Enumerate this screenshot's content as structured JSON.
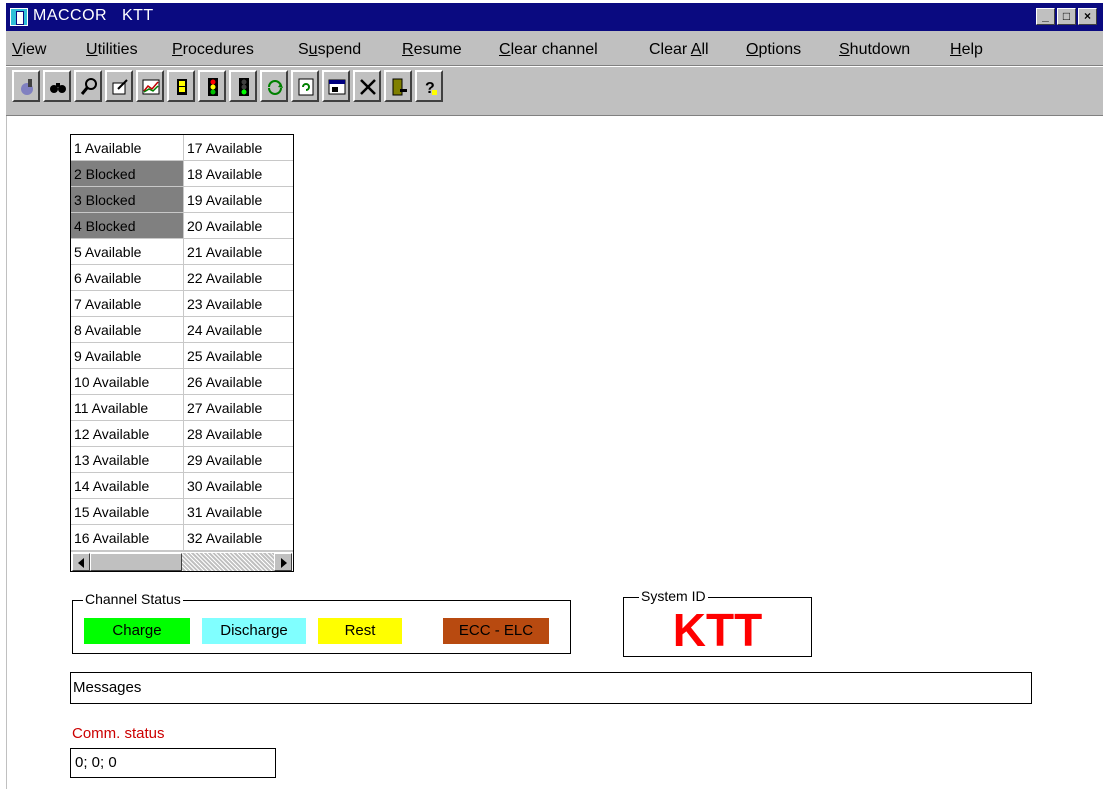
{
  "window": {
    "app_name": "MACCOR",
    "system": "KTT",
    "min_glyph": "_",
    "max_glyph": "□",
    "close_glyph": "×"
  },
  "menu": {
    "items": [
      {
        "label": "View",
        "underline": "V",
        "rest": "iew"
      },
      {
        "label": "Utilities",
        "underline": "U",
        "rest": "tilities"
      },
      {
        "label": "Procedures",
        "underline": "P",
        "rest": "rocedures"
      },
      {
        "label": "Suspend",
        "pre": "S",
        "underline": "u",
        "rest": "spend"
      },
      {
        "label": "Resume",
        "underline": "R",
        "rest": "esume"
      },
      {
        "label": "Clear channel",
        "underline": "C",
        "rest": "lear channel"
      },
      {
        "label": "Clear All",
        "pre": "Clear ",
        "underline": "A",
        "rest": "ll"
      },
      {
        "label": "Options",
        "underline": "O",
        "rest": "ptions"
      },
      {
        "label": "Shutdown",
        "underline": "S",
        "rest": "hutdown"
      },
      {
        "label": "Help",
        "underline": "H",
        "rest": "elp"
      }
    ]
  },
  "toolbar": {
    "icons": [
      "run-test-icon",
      "binoculars-icon",
      "magnifier-icon",
      "edit-icon",
      "graph-icon",
      "battery-icon",
      "traffic-light-icon",
      "traffic-light-green-icon",
      "cycle-icon",
      "refresh-page-icon",
      "window-icon",
      "delete-icon",
      "door-exit-icon",
      "help-icon"
    ]
  },
  "channels": {
    "column1": [
      {
        "text": "1 Available",
        "state": "available"
      },
      {
        "text": "2 Blocked",
        "state": "blocked"
      },
      {
        "text": "3 Blocked",
        "state": "blocked"
      },
      {
        "text": "4 Blocked",
        "state": "blocked"
      },
      {
        "text": "5 Available",
        "state": "available"
      },
      {
        "text": "6 Available",
        "state": "available"
      },
      {
        "text": "7 Available",
        "state": "available"
      },
      {
        "text": "8 Available",
        "state": "available"
      },
      {
        "text": "9 Available",
        "state": "available"
      },
      {
        "text": "10 Available",
        "state": "available"
      },
      {
        "text": "11 Available",
        "state": "available"
      },
      {
        "text": "12 Available",
        "state": "available"
      },
      {
        "text": "13 Available",
        "state": "available"
      },
      {
        "text": "14 Available",
        "state": "available"
      },
      {
        "text": "15 Available",
        "state": "available"
      },
      {
        "text": "16 Available",
        "state": "available"
      }
    ],
    "column2": [
      {
        "text": "17 Available",
        "state": "available"
      },
      {
        "text": "18 Available",
        "state": "available"
      },
      {
        "text": "19 Available",
        "state": "available"
      },
      {
        "text": "20 Available",
        "state": "available"
      },
      {
        "text": "21 Available",
        "state": "available"
      },
      {
        "text": "22 Available",
        "state": "available"
      },
      {
        "text": "23 Available",
        "state": "available"
      },
      {
        "text": "24 Available",
        "state": "available"
      },
      {
        "text": "25 Available",
        "state": "available"
      },
      {
        "text": "26 Available",
        "state": "available"
      },
      {
        "text": "27 Available",
        "state": "available"
      },
      {
        "text": "28 Available",
        "state": "available"
      },
      {
        "text": "29 Available",
        "state": "available"
      },
      {
        "text": "30 Available",
        "state": "available"
      },
      {
        "text": "31 Available",
        "state": "available"
      },
      {
        "text": "32 Available",
        "state": "available"
      }
    ]
  },
  "channel_status": {
    "title": "Channel Status",
    "legend": [
      {
        "label": "Charge",
        "color": "#00ff00"
      },
      {
        "label": "Discharge",
        "color": "#80ffff"
      },
      {
        "label": "Rest",
        "color": "#ffff00"
      },
      {
        "label": "ECC - ELC",
        "color": "#b84a10"
      }
    ]
  },
  "system_id": {
    "title": "System ID",
    "value": "KTT",
    "color": "#ff0000"
  },
  "messages": {
    "text": "Messages"
  },
  "comm": {
    "label": "Comm. status",
    "value": "0; 0; 0"
  }
}
